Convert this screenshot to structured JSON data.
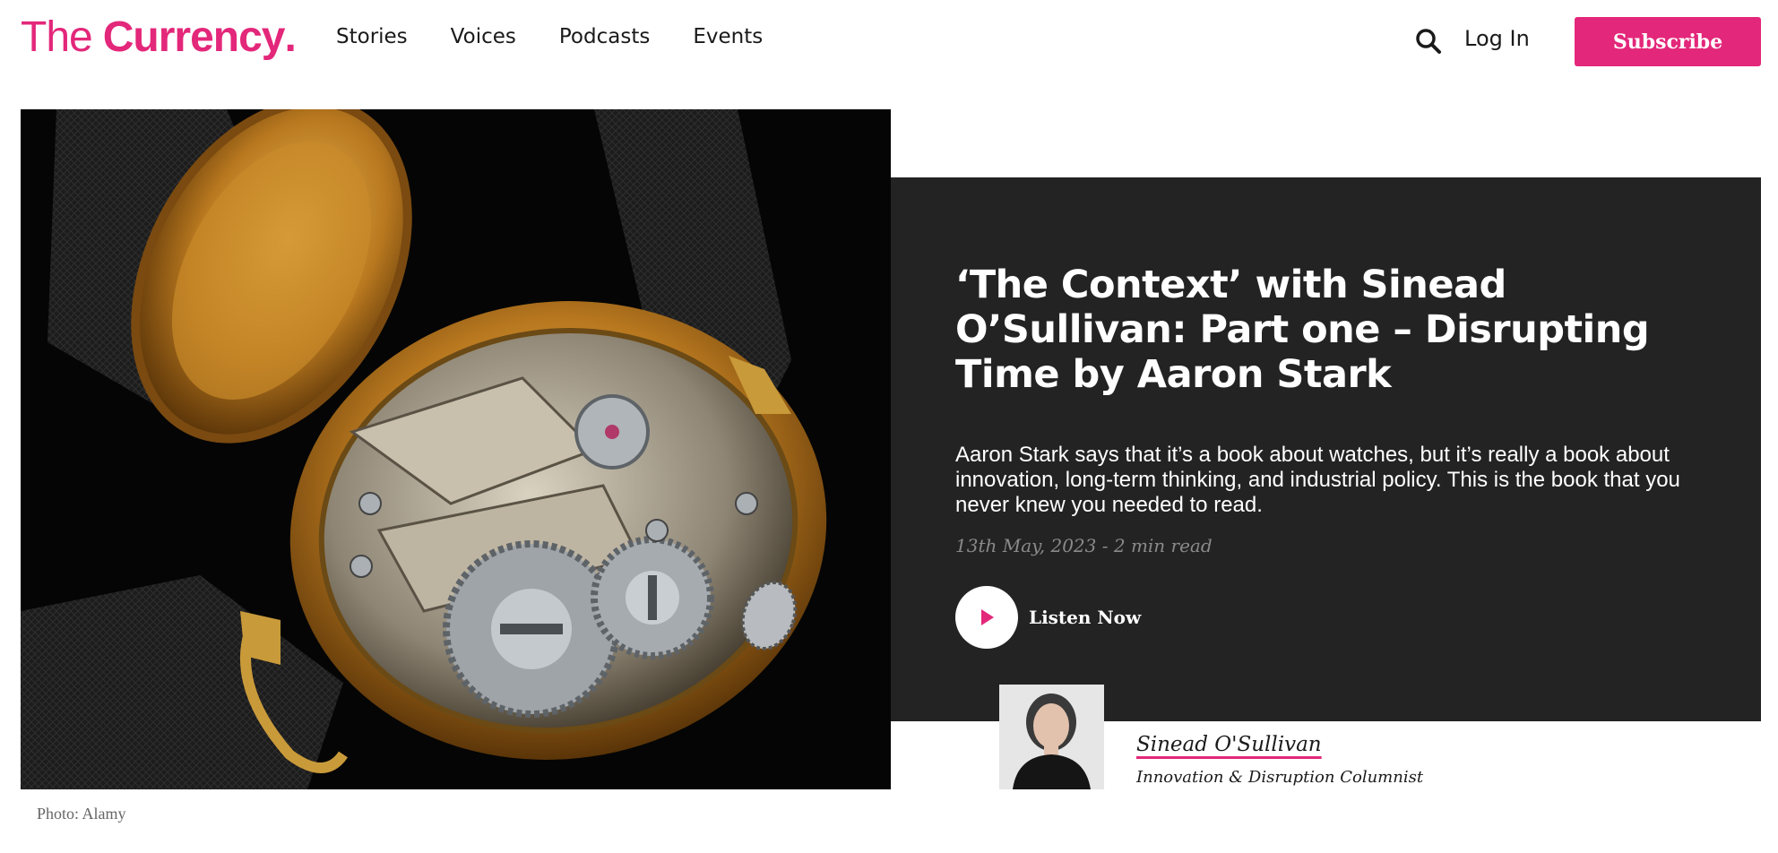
{
  "logo": {
    "part1": "The",
    "part2": "Currency",
    "dot": "."
  },
  "nav": [
    "Stories",
    "Voices",
    "Podcasts",
    "Events"
  ],
  "header": {
    "login_label": "Log In",
    "subscribe_label": "Subscribe",
    "search_icon": "search-icon"
  },
  "hero": {
    "caption": "Photo: Alamy",
    "image": "pocket-watch-movement-photo"
  },
  "article": {
    "title": "‘The Context’ with Sinead O’Sullivan: Part one – Disrupting Time by Aaron Stark",
    "excerpt": "Aaron Stark says that it’s a book about watches, but it’s really a book about innovation, long-term thinking, and industrial policy. This is the book that you never knew you needed to read.",
    "meta": "13th May, 2023 - 2 min read",
    "listen_label": "Listen Now"
  },
  "author": {
    "name": "Sinead O'Sullivan",
    "role": "Innovation & Disruption Columnist"
  },
  "colors": {
    "brand": "#e3277a",
    "panel": "#232323"
  }
}
